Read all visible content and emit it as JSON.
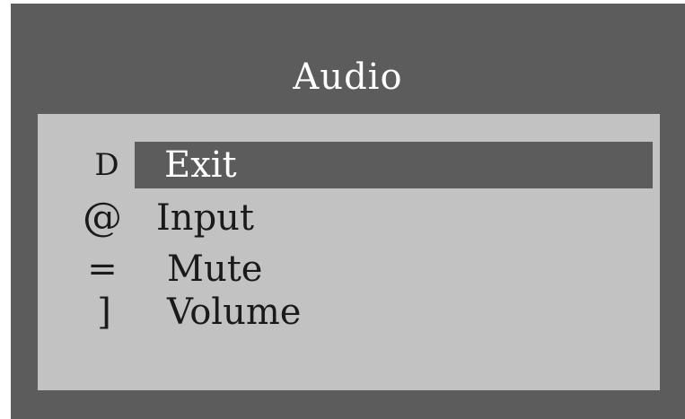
{
  "osd": {
    "title": "Audio",
    "items": [
      {
        "icon_glyph": "D",
        "icon_name": "exit-icon",
        "label": "Exit",
        "selected": true
      },
      {
        "icon_glyph": "@",
        "icon_name": "input-icon",
        "label": "Input",
        "selected": false
      },
      {
        "icon_glyph": "=",
        "icon_name": "mute-icon",
        "label": "Mute",
        "selected": false
      },
      {
        "icon_glyph": "]",
        "icon_name": "volume-icon",
        "label": "Volume",
        "selected": false
      }
    ]
  },
  "colors": {
    "frame": "#5c5c5c",
    "panel": "#c2c2c2",
    "highlight": "#5c5c5c",
    "text": "#1a1a1a",
    "selected_text": "#ffffff"
  }
}
